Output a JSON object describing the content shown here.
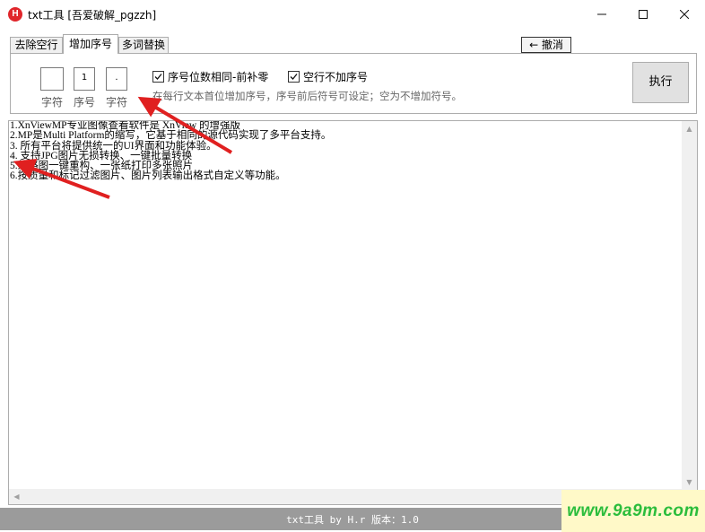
{
  "window": {
    "title": "txt工具 [吾爱破解_pgzzh]",
    "app_icon_letter": "H"
  },
  "tabs": [
    {
      "label": "去除空行",
      "active": false
    },
    {
      "label": "增加序号",
      "active": true
    },
    {
      "label": "多词替换",
      "active": false
    }
  ],
  "toolbar": {
    "undo_label": "← 撤消"
  },
  "panel": {
    "prefix_value": "",
    "number_value": "1",
    "suffix_value": ".",
    "prefix_label": "字符",
    "number_label": "序号",
    "suffix_label": "字符",
    "check_same_digits": {
      "label": "序号位数相同-前补零",
      "checked": true
    },
    "check_skip_empty": {
      "label": "空行不加序号",
      "checked": true
    },
    "hint": "在每行文本首位增加序号，序号前后符号可设定；空为不增加符号。",
    "exec_label": "执行"
  },
  "text_lines": [
    "1.XnViewMP专业图像查看软件是 XnView 的增强版",
    "2.MP是Multi Platform的缩写，它基于相同的源代码实现了多平台支持。",
    "3. 所有平台将提供统一的UI界面和功能体验。",
    "4. 支持JPG图片无损转换、一键批量转换",
    "5.缩略图一键重构、一张纸打印多张照片",
    "6.按质量和标记过滤图片、图片列表输出格式自定义等功能。"
  ],
  "status": {
    "text": "txt工具 by H.r  版本：1.0"
  },
  "watermark": {
    "text": "www.9a9m.com"
  },
  "colors": {
    "accent_red": "#e0262b",
    "status_bg": "#9b9b9b",
    "watermark_green": "#2bbd3c",
    "watermark_bg": "#fff9c8"
  }
}
